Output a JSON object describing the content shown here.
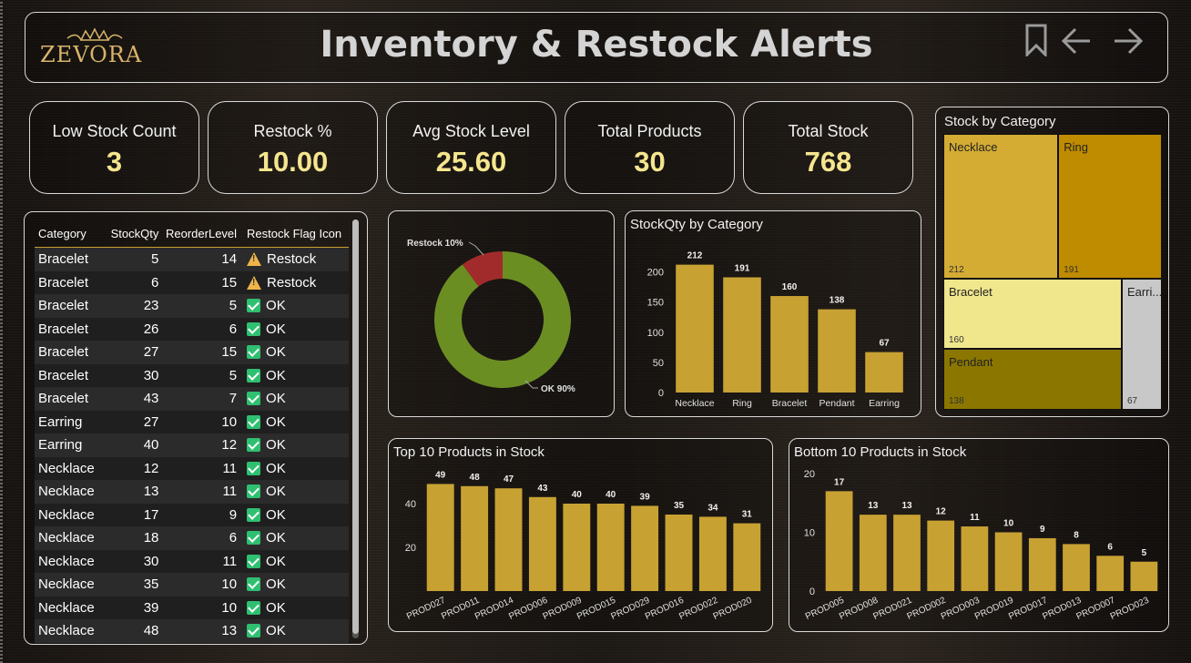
{
  "header": {
    "logo_text": "ZEVORA",
    "title": "Inventory & Restock Alerts",
    "icons": [
      "bookmark-icon",
      "arrow-left-icon",
      "arrow-right-icon"
    ]
  },
  "kpis": [
    {
      "label": "Low Stock Count",
      "value": "3"
    },
    {
      "label": "Restock %",
      "value": "10.00"
    },
    {
      "label": "Avg Stock Level",
      "value": "25.60"
    },
    {
      "label": "Total Products",
      "value": "30"
    },
    {
      "label": "Total Stock",
      "value": "768"
    }
  ],
  "table": {
    "headers": [
      "Category",
      "StockQty",
      "ReorderLevel",
      "Restock Flag Icon"
    ],
    "rows": [
      {
        "category": "Bracelet",
        "qty": "5",
        "reorder": "14",
        "icon": "warning-icon",
        "flag": "Restock"
      },
      {
        "category": "Bracelet",
        "qty": "6",
        "reorder": "15",
        "icon": "warning-icon",
        "flag": "Restock"
      },
      {
        "category": "Bracelet",
        "qty": "23",
        "reorder": "5",
        "icon": "check-icon",
        "flag": "OK"
      },
      {
        "category": "Bracelet",
        "qty": "26",
        "reorder": "6",
        "icon": "check-icon",
        "flag": "OK"
      },
      {
        "category": "Bracelet",
        "qty": "27",
        "reorder": "15",
        "icon": "check-icon",
        "flag": "OK"
      },
      {
        "category": "Bracelet",
        "qty": "30",
        "reorder": "5",
        "icon": "check-icon",
        "flag": "OK"
      },
      {
        "category": "Bracelet",
        "qty": "43",
        "reorder": "7",
        "icon": "check-icon",
        "flag": "OK"
      },
      {
        "category": "Earring",
        "qty": "27",
        "reorder": "10",
        "icon": "check-icon",
        "flag": "OK"
      },
      {
        "category": "Earring",
        "qty": "40",
        "reorder": "12",
        "icon": "check-icon",
        "flag": "OK"
      },
      {
        "category": "Necklace",
        "qty": "12",
        "reorder": "11",
        "icon": "check-icon",
        "flag": "OK"
      },
      {
        "category": "Necklace",
        "qty": "13",
        "reorder": "11",
        "icon": "check-icon",
        "flag": "OK"
      },
      {
        "category": "Necklace",
        "qty": "17",
        "reorder": "9",
        "icon": "check-icon",
        "flag": "OK"
      },
      {
        "category": "Necklace",
        "qty": "18",
        "reorder": "6",
        "icon": "check-icon",
        "flag": "OK"
      },
      {
        "category": "Necklace",
        "qty": "30",
        "reorder": "11",
        "icon": "check-icon",
        "flag": "OK"
      },
      {
        "category": "Necklace",
        "qty": "35",
        "reorder": "10",
        "icon": "check-icon",
        "flag": "OK"
      },
      {
        "category": "Necklace",
        "qty": "39",
        "reorder": "10",
        "icon": "check-icon",
        "flag": "OK"
      },
      {
        "category": "Necklace",
        "qty": "48",
        "reorder": "13",
        "icon": "check-icon",
        "flag": "OK"
      }
    ]
  },
  "colors": {
    "gold": "#c8a133",
    "restock": "#a12b2b",
    "ok": "#6b8e23",
    "kpi_value": "#f5e58e"
  },
  "chart_data": [
    {
      "type": "pie",
      "title": "",
      "labels": [
        "Restock 10%",
        "OK 90%"
      ],
      "values": [
        10,
        90
      ],
      "colors": [
        "#a12b2b",
        "#6b8e23"
      ]
    },
    {
      "type": "bar",
      "title": "StockQty by Category",
      "categories": [
        "Necklace",
        "Ring",
        "Bracelet",
        "Pendant",
        "Earring"
      ],
      "values": [
        212,
        191,
        160,
        138,
        67
      ],
      "yticks": [
        "0",
        "50",
        "100",
        "150",
        "200"
      ],
      "ylim": [
        0,
        225
      ]
    },
    {
      "type": "treemap",
      "title": "Stock by Category",
      "labels": [
        "Necklace",
        "Ring",
        "Bracelet",
        "Pendant",
        "Earri..."
      ],
      "values": [
        212,
        191,
        160,
        138,
        67
      ],
      "value_labels": [
        "212",
        "191",
        "160",
        "138",
        "67"
      ],
      "colors": [
        "#d4ac33",
        "#bf8c00",
        "#f0e68c",
        "#8b7600",
        "#c8c8c8"
      ]
    },
    {
      "type": "bar",
      "title": "Top 10 Products in Stock",
      "categories": [
        "PROD027",
        "PROD011",
        "PROD014",
        "PROD006",
        "PROD009",
        "PROD015",
        "PROD029",
        "PROD016",
        "PROD022",
        "PROD020"
      ],
      "values": [
        49,
        48,
        47,
        43,
        40,
        40,
        39,
        35,
        34,
        31
      ],
      "yticks": [
        "20",
        "40"
      ],
      "ylim": [
        0,
        55
      ]
    },
    {
      "type": "bar",
      "title": "Bottom 10 Products in Stock",
      "categories": [
        "PROD005",
        "PROD008",
        "PROD021",
        "PROD002",
        "PROD003",
        "PROD019",
        "PROD017",
        "PROD013",
        "PROD007",
        "PROD023"
      ],
      "values": [
        17,
        13,
        13,
        12,
        11,
        10,
        9,
        8,
        6,
        5
      ],
      "yticks": [
        "0",
        "10",
        "20"
      ],
      "ylim": [
        0,
        20
      ]
    }
  ]
}
